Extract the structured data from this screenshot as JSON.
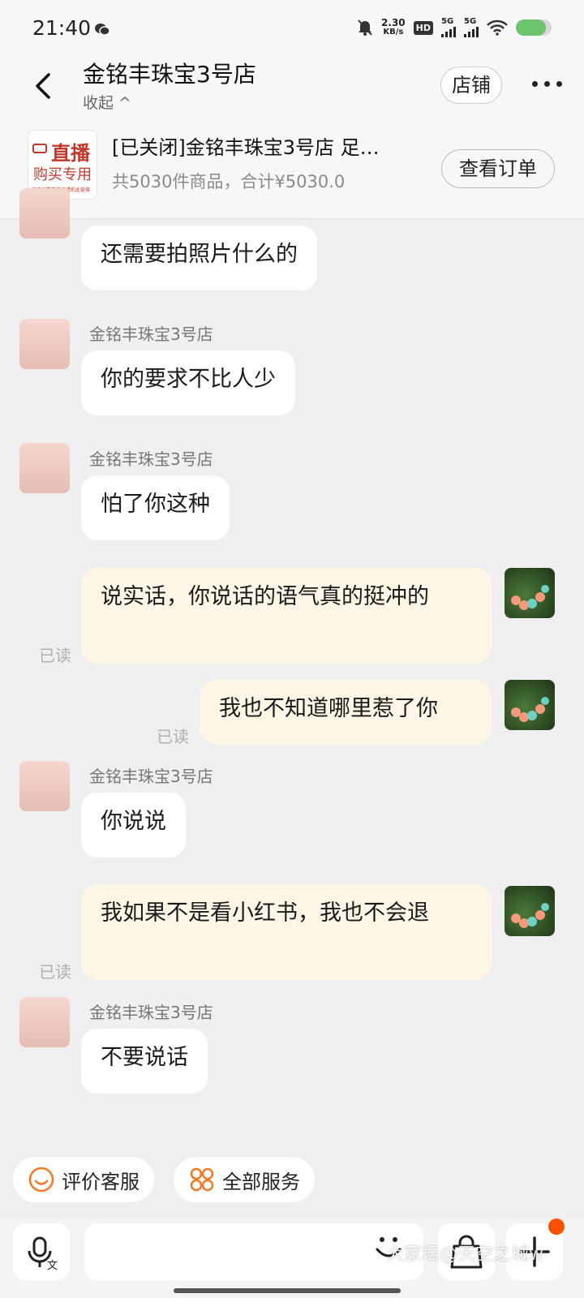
{
  "status_bar": {
    "time": "21:40",
    "net_speed_value": "2.30",
    "net_speed_unit": "KB/s",
    "hd": "HD",
    "sim1": "5G",
    "sim2": "5G",
    "battery_level": 0.85,
    "battery_color": "#6cc56c"
  },
  "header": {
    "title": "金铭丰珠宝3号店",
    "collapse_label": "收起 ^",
    "store_button": "店铺"
  },
  "order": {
    "thumb_line1": "直播",
    "thumb_line2": "购买专用",
    "thumb_line3": "直播间看货购买请拍此链接",
    "title": "[已关闭]金铭丰珠宝3号店 足…",
    "subtitle": "共5030件商品，合计¥5030.0",
    "view_button": "查看订单"
  },
  "messages": [
    {
      "text": "还需要拍照片什么的"
    },
    {
      "sender": "金铭丰珠宝3号店",
      "text": "你的要求不比人少"
    },
    {
      "sender": "金铭丰珠宝3号店",
      "text": "怕了你这种"
    },
    {
      "text": "说实话，你说话的语气真的挺冲的",
      "read": "已读"
    },
    {
      "text": "我也不知道哪里惹了你",
      "read": "已读"
    },
    {
      "sender": "金铭丰珠宝3号店",
      "text": "你说说"
    },
    {
      "text": "我如果不是看小红书，我也不会退",
      "read": "已读"
    },
    {
      "sender": "金铭丰珠宝3号店",
      "text": "不要说话"
    }
  ],
  "quick_actions": {
    "rate_service": "评价客服",
    "all_services": "全部服务"
  },
  "input": {
    "placeholder": ""
  },
  "watermark": "大家坛@天空之城w",
  "colors": {
    "accent": "#ff5000",
    "bubble_out": "#fdf6e6",
    "icon_orange": "#f07a22"
  }
}
